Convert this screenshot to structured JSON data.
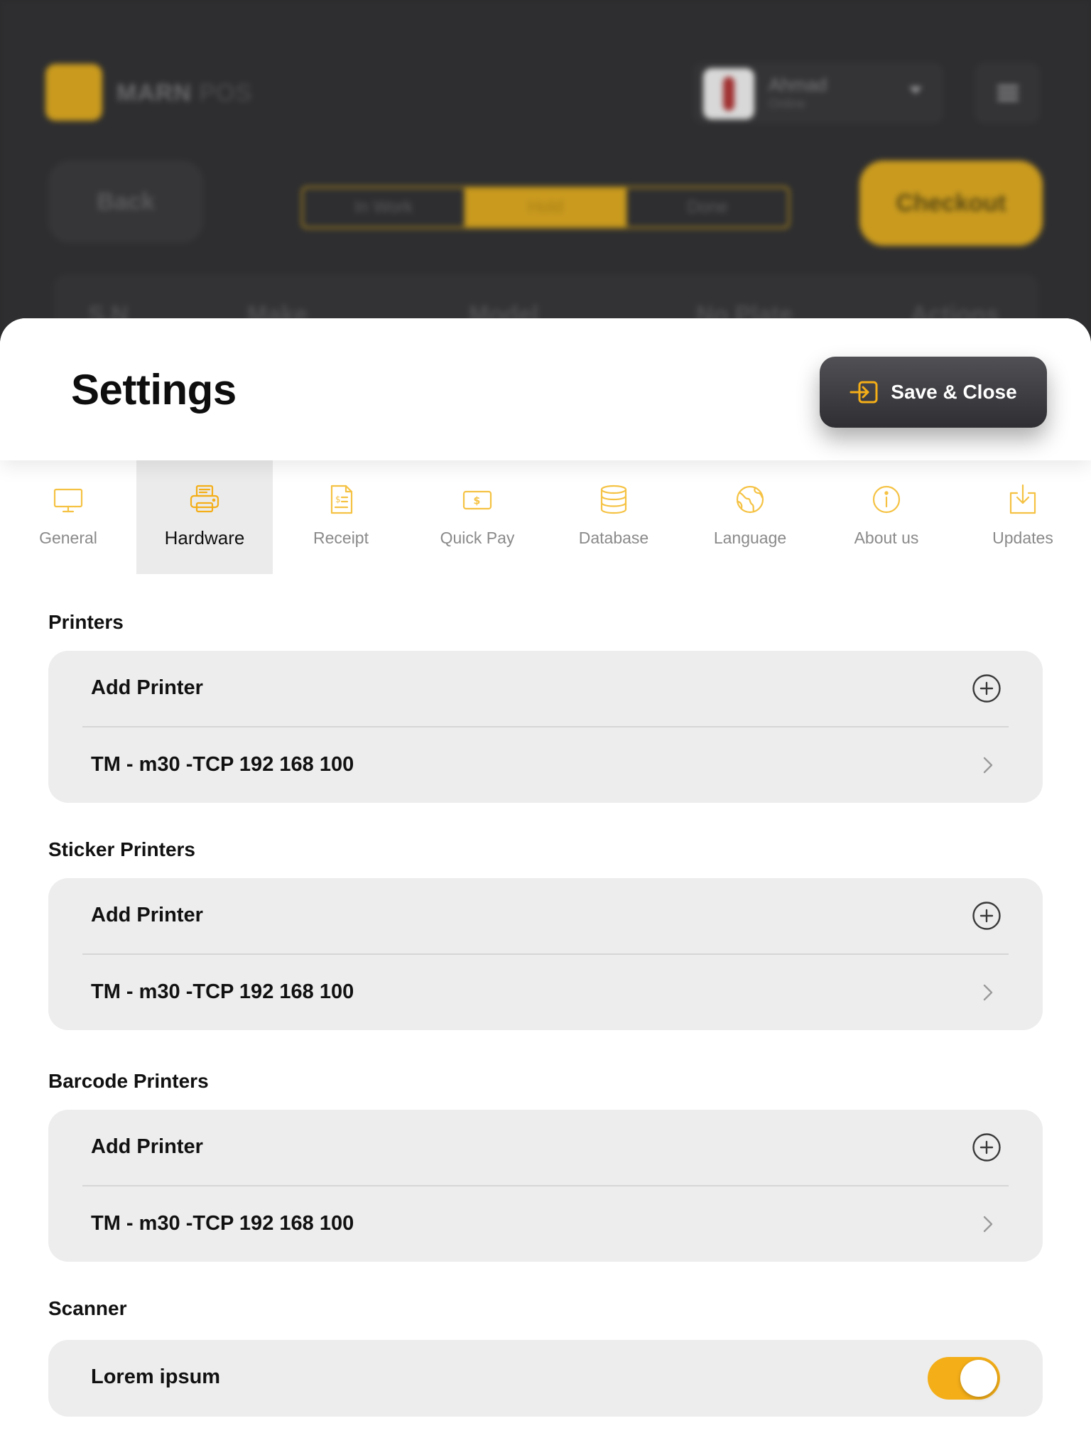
{
  "background_app": {
    "brand": "MARN",
    "brand_suffix": "POS",
    "user_name": "Ahmad",
    "user_status": "Online",
    "back_label": "Back",
    "segments": [
      "In Work",
      "Hold",
      "Done"
    ],
    "active_segment": "Hold",
    "checkout_label": "Checkout",
    "table_headers": [
      "S.N",
      "Make",
      "Model",
      "No Plate",
      "Actions"
    ]
  },
  "settings": {
    "title": "Settings",
    "save_label": "Save & Close"
  },
  "tabs": [
    {
      "label": "General",
      "icon": "monitor-icon"
    },
    {
      "label": "Hardware",
      "icon": "printer-icon",
      "active": true
    },
    {
      "label": "Receipt",
      "icon": "receipt-icon"
    },
    {
      "label": "Quick Pay",
      "icon": "cash-icon"
    },
    {
      "label": "Database",
      "icon": "database-icon"
    },
    {
      "label": "Language",
      "icon": "globe-icon"
    },
    {
      "label": "About us",
      "icon": "info-icon"
    },
    {
      "label": "Updates",
      "icon": "download-icon"
    }
  ],
  "sections": {
    "printers": {
      "title": "Printers",
      "add_label": "Add Printer",
      "items": [
        "TM - m30 -TCP 192 168 100"
      ]
    },
    "sticker_printers": {
      "title": "Sticker Printers",
      "add_label": "Add Printer",
      "items": [
        "TM - m30 -TCP 192 168 100"
      ]
    },
    "barcode_printers": {
      "title": "Barcode Printers",
      "add_label": "Add Printer",
      "items": [
        "TM - m30 -TCP 192 168 100"
      ]
    },
    "scanner": {
      "title": "Scanner",
      "option_label": "Lorem ipsum",
      "option_enabled": true
    }
  },
  "colors": {
    "accent": "#F4AE18",
    "tab_icon": "#F5C243",
    "dark_button": "#3A3A3E",
    "card_bg": "#EDEDED"
  }
}
